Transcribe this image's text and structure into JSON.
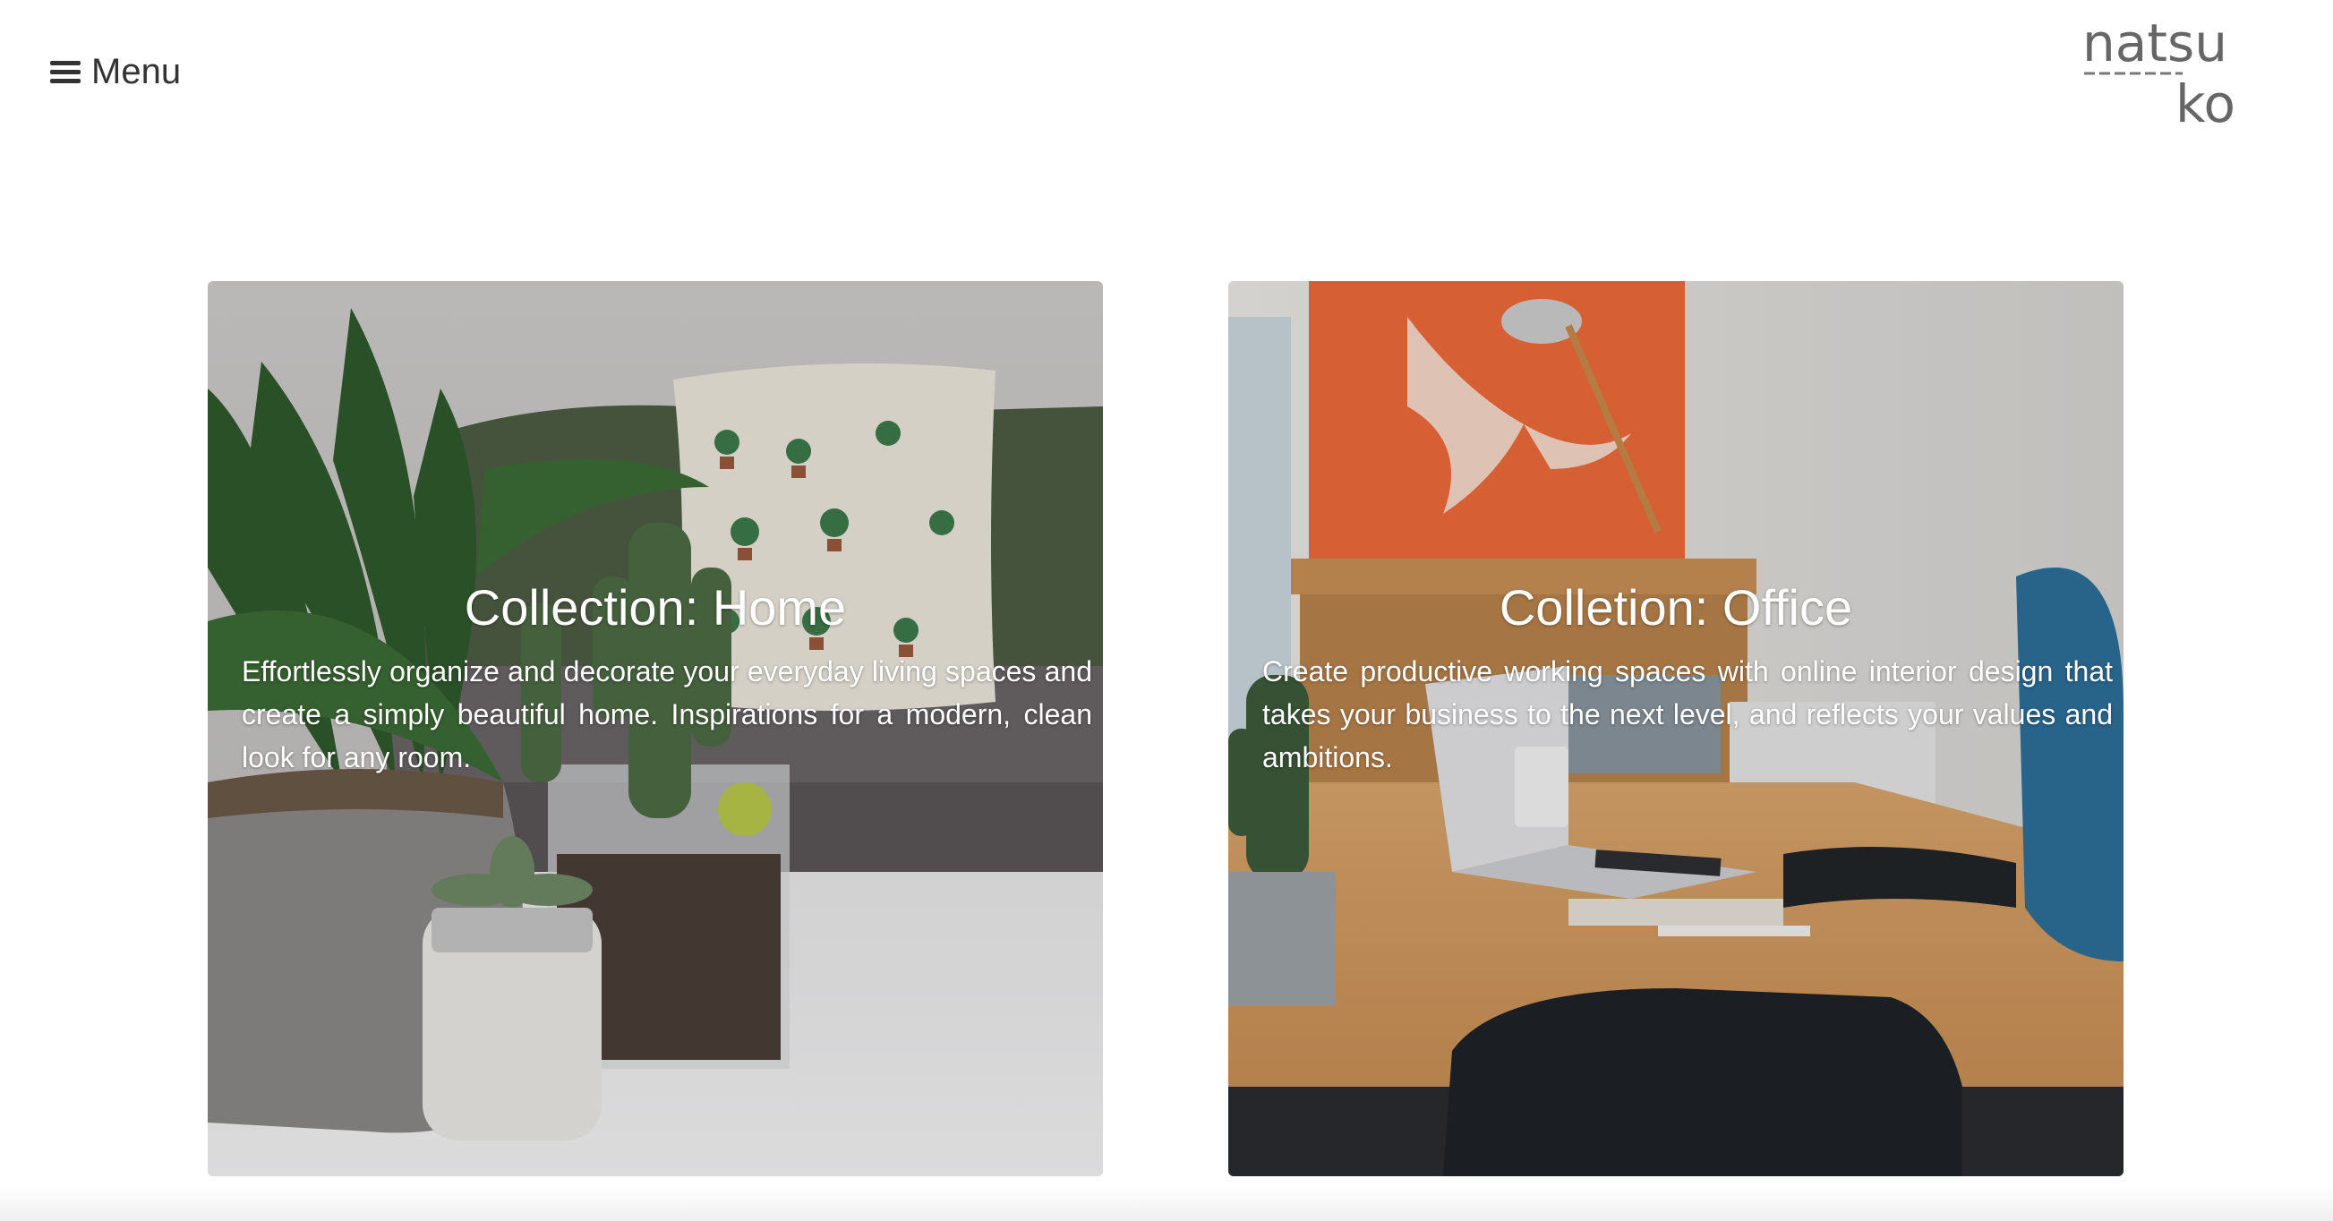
{
  "header": {
    "menu_label": "Menu",
    "logo_top": "natsu",
    "logo_bottom": "ko"
  },
  "cards": [
    {
      "title": "Collection: Home",
      "description": "Effortlessly organize and decorate your everyday living spaces and create a simply beautiful home. Inspirations for a modern, clean look for any room."
    },
    {
      "title": "Colletion: Office",
      "description": "Create productive working spaces with online interior design that takes your business to the next level, and reflects your values and ambitions."
    }
  ],
  "colors": {
    "text": "#333333",
    "card_text": "#ffffff",
    "background": "#ffffff"
  },
  "icons": {
    "menu": "hamburger-icon"
  }
}
